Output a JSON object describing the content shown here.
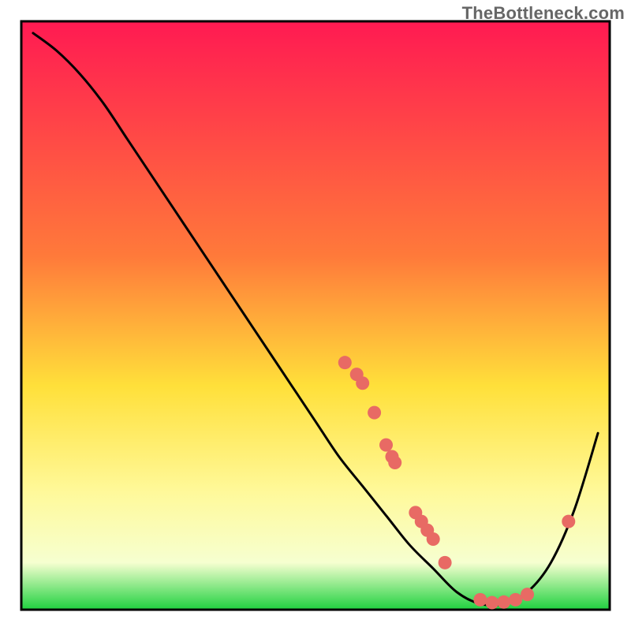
{
  "watermark": "TheBottleneck.com",
  "chart_data": {
    "type": "line",
    "title": "",
    "xlabel": "",
    "ylabel": "",
    "xlim": [
      0,
      100
    ],
    "ylim": [
      0,
      100
    ],
    "background_gradient": {
      "stops": [
        {
          "offset": 0,
          "color": "#ff1a52"
        },
        {
          "offset": 40,
          "color": "#ff7a3a"
        },
        {
          "offset": 62,
          "color": "#ffe03a"
        },
        {
          "offset": 80,
          "color": "#fff99a"
        },
        {
          "offset": 92,
          "color": "#f6ffd0"
        },
        {
          "offset": 100,
          "color": "#1fd13f"
        }
      ]
    },
    "series": [
      {
        "name": "bottleneck-curve",
        "color": "#000000",
        "x": [
          2,
          6,
          10,
          14,
          18,
          22,
          26,
          30,
          34,
          38,
          42,
          46,
          50,
          54,
          58,
          62,
          66,
          70,
          74,
          78,
          82,
          86,
          90,
          94,
          98
        ],
        "y": [
          98,
          95,
          91,
          86,
          80,
          74,
          68,
          62,
          56,
          50,
          44,
          38,
          32,
          26,
          21,
          16,
          11,
          7,
          3,
          1,
          1,
          3,
          8,
          17,
          30
        ]
      },
      {
        "name": "sample-points",
        "type": "scatter",
        "color": "#e86a64",
        "x": [
          55,
          57,
          58,
          60,
          62,
          63,
          63.5,
          67,
          68,
          69,
          70,
          72,
          78,
          80,
          82,
          84,
          86,
          93
        ],
        "y": [
          42,
          40,
          38.5,
          33.5,
          28,
          26,
          25,
          16.5,
          15,
          13.5,
          12,
          8,
          1.7,
          1.2,
          1.3,
          1.7,
          2.6,
          15
        ]
      }
    ]
  }
}
